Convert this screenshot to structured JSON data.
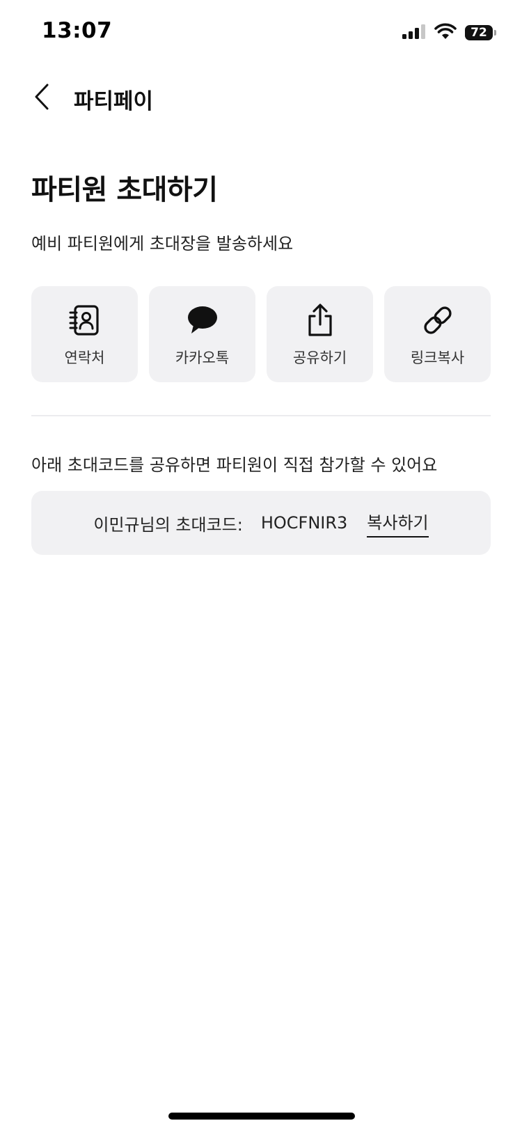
{
  "status_bar": {
    "time": "13:07",
    "battery_level": "72",
    "icons": [
      "signal-icon",
      "wifi-icon",
      "battery-icon"
    ]
  },
  "header": {
    "title": "파티페이",
    "back_icon": "chevron-left-icon"
  },
  "main": {
    "title": "파티원 초대하기",
    "subtitle": "예비 파티원에게 초대장을 발송하세요",
    "share_options": [
      {
        "label": "연락처",
        "icon": "contacts-icon"
      },
      {
        "label": "카카오톡",
        "icon": "chat-bubble-icon"
      },
      {
        "label": "공유하기",
        "icon": "share-icon"
      },
      {
        "label": "링크복사",
        "icon": "link-icon"
      }
    ],
    "code_description": "아래 초대코드를 공유하면 파티원이 직접 참가할 수 있어요",
    "code_label": "이민규님의 초대코드:",
    "code_value": "HOCFNIR3",
    "copy_label": "복사하기"
  },
  "colors": {
    "card_background": "#f1f1f3",
    "text_primary": "#111111",
    "divider": "#ececee"
  }
}
